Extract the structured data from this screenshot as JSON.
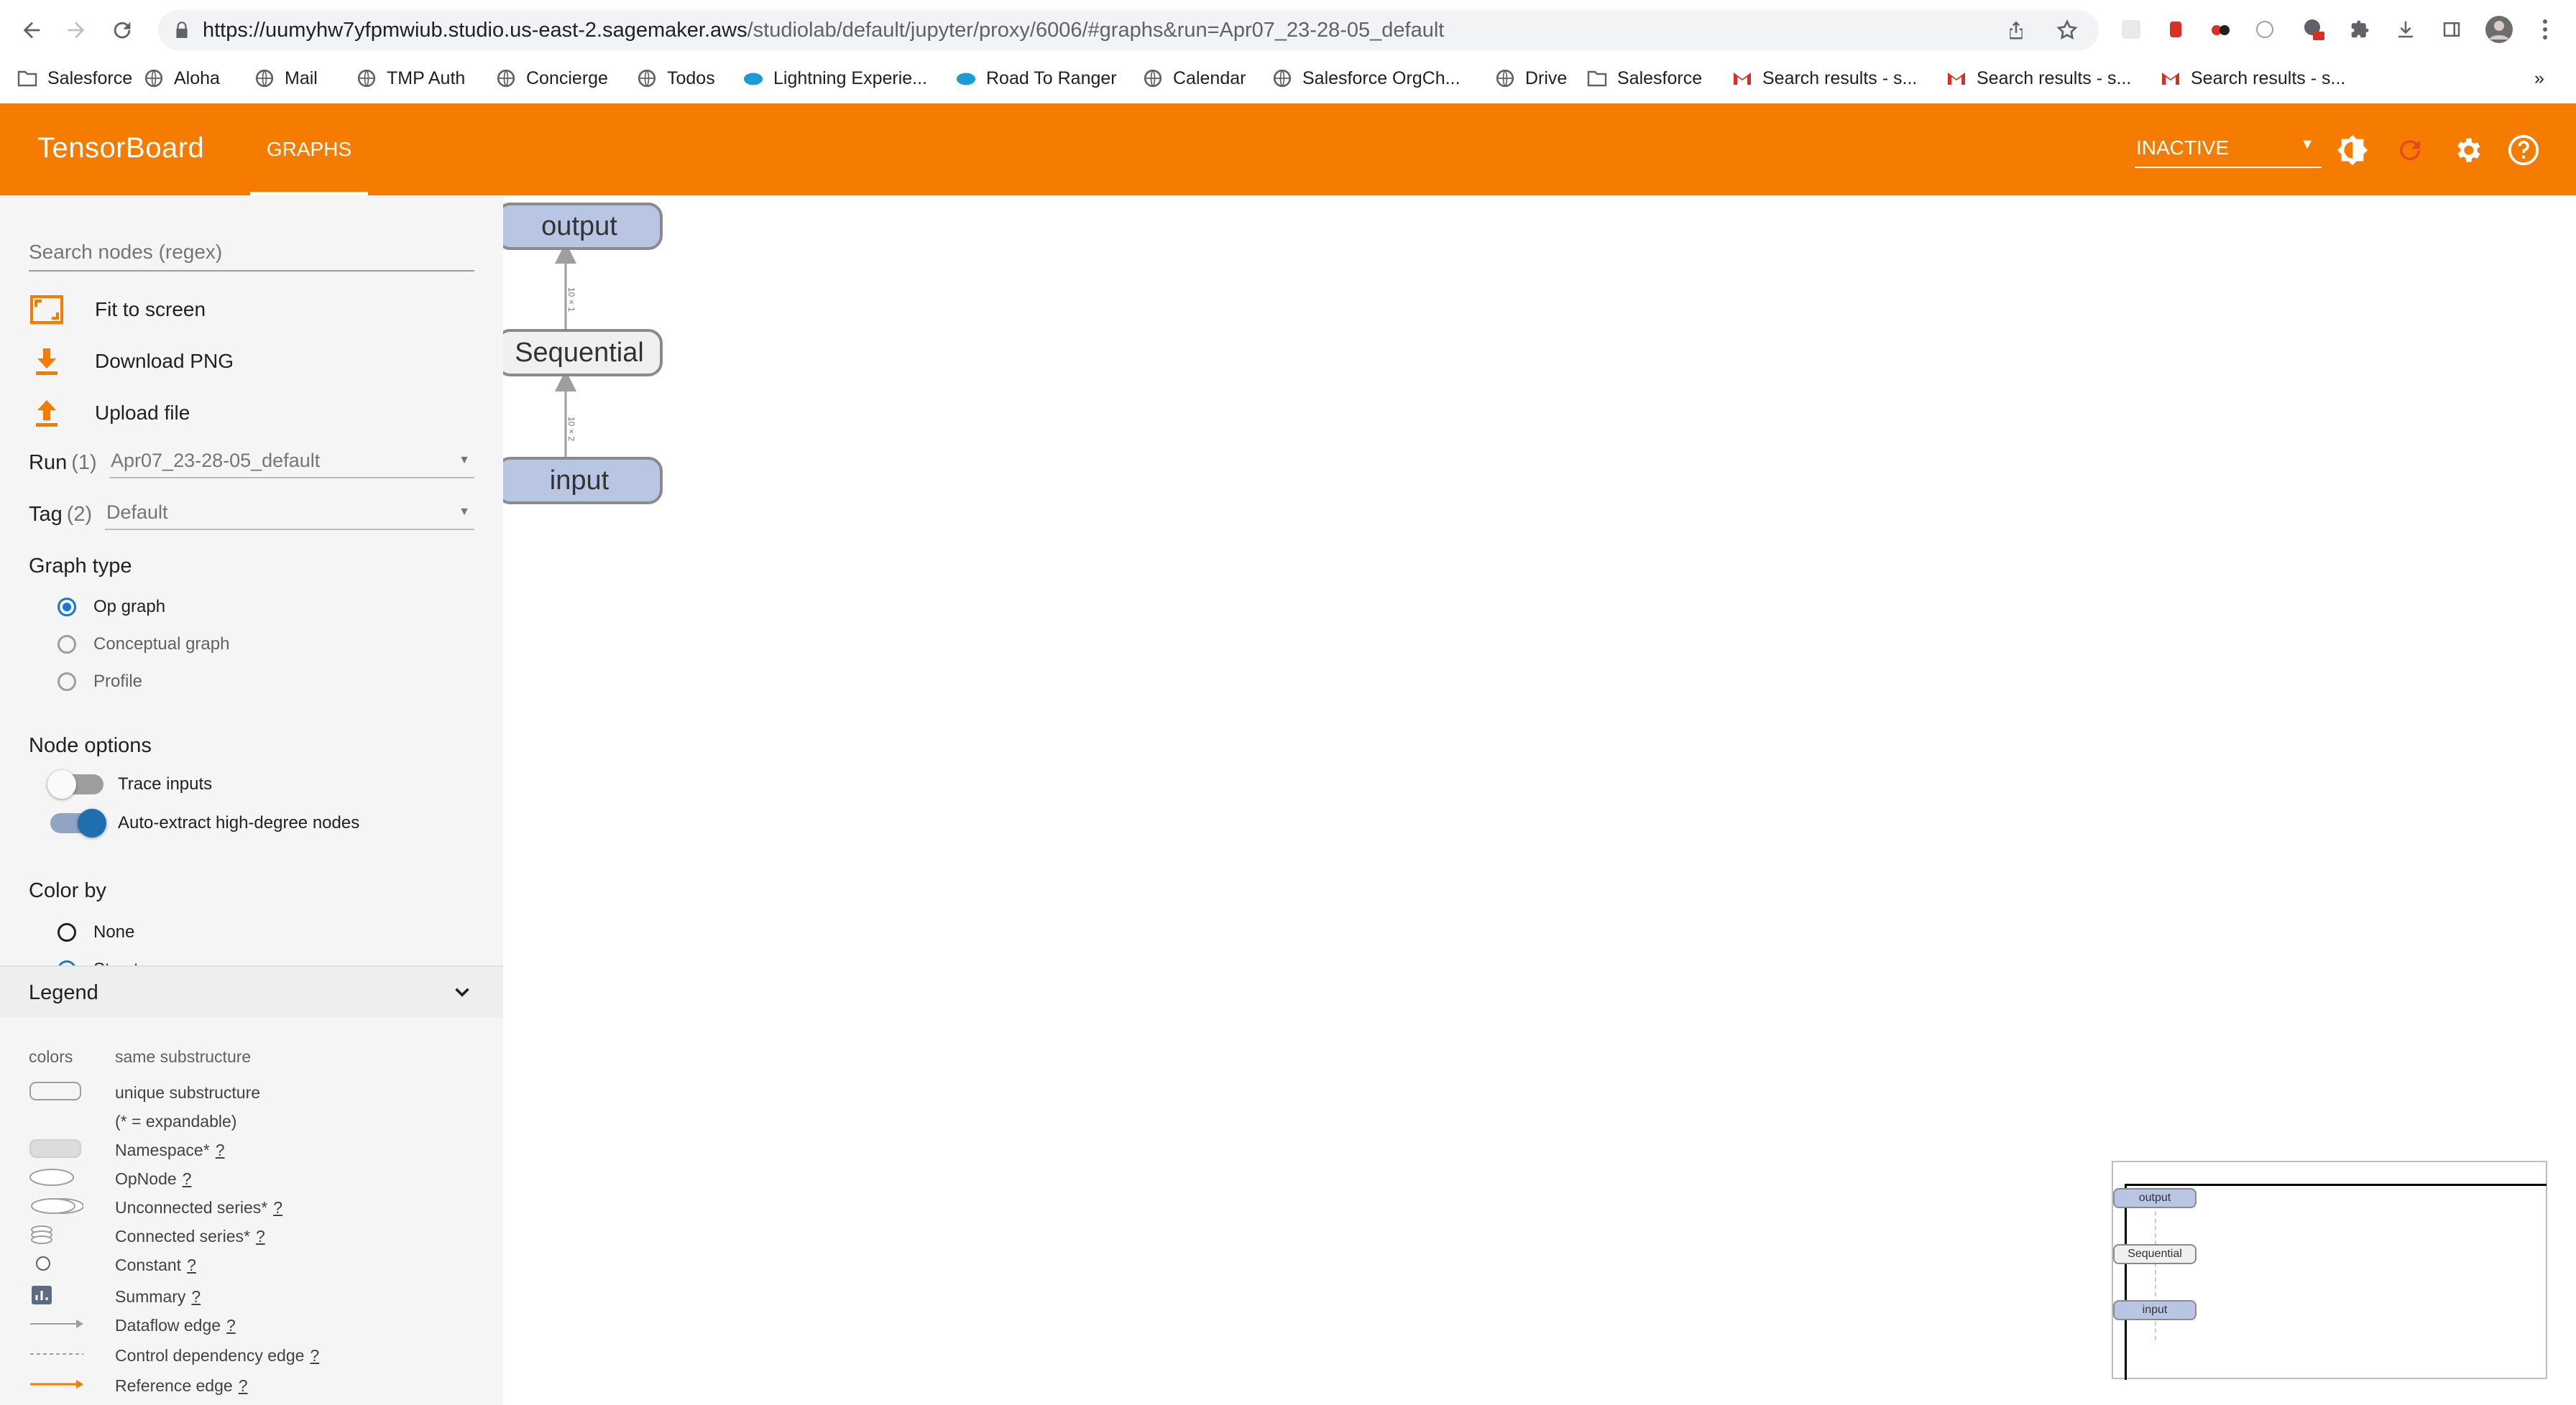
{
  "browser": {
    "url_host": "https://uumyhw7yfpmwiub.studio.us-east-2.sagemaker.aws",
    "url_path": "/studiolab/default/jupyter/proxy/6006/#graphs&run=Apr07_23-28-05_default",
    "bookmarks": [
      {
        "label": "Salesforce",
        "icon": "salesforce-folder-icon"
      },
      {
        "label": "Aloha",
        "icon": "globe-icon"
      },
      {
        "label": "Mail",
        "icon": "globe-icon"
      },
      {
        "label": "TMP Auth",
        "icon": "globe-icon"
      },
      {
        "label": "Concierge",
        "icon": "globe-icon"
      },
      {
        "label": "Todos",
        "icon": "globe-icon"
      },
      {
        "label": "Lightning Experie...",
        "icon": "salesforce-cloud-icon"
      },
      {
        "label": "Road To Ranger",
        "icon": "salesforce-cloud-icon"
      },
      {
        "label": "Calendar",
        "icon": "globe-icon"
      },
      {
        "label": "Salesforce OrgCh...",
        "icon": "globe-icon"
      },
      {
        "label": "Drive",
        "icon": "globe-icon"
      },
      {
        "label": "Salesforce",
        "icon": "folder-icon"
      },
      {
        "label": "Search results - s...",
        "icon": "gmail-icon"
      },
      {
        "label": "Search results - s...",
        "icon": "gmail-icon"
      },
      {
        "label": "Search results - s...",
        "icon": "gmail-icon"
      }
    ],
    "more_bookmarks": "»"
  },
  "header": {
    "logo": "TensorBoard",
    "tab": "GRAPHS",
    "status": "INACTIVE",
    "accent_color": "#f57c00"
  },
  "sidebar": {
    "search_placeholder": "Search nodes (regex)",
    "actions": {
      "fit": "Fit to screen",
      "download": "Download PNG",
      "upload": "Upload file"
    },
    "run": {
      "label": "Run",
      "count": "(1)",
      "value": "Apr07_23-28-05_default"
    },
    "tag": {
      "label": "Tag",
      "count": "(2)",
      "value": "Default"
    },
    "graph_type": {
      "title": "Graph type",
      "options": [
        "Op graph",
        "Conceptual graph",
        "Profile"
      ],
      "selected": "Op graph"
    },
    "node_options": {
      "title": "Node options",
      "trace_inputs": "Trace inputs",
      "auto_extract": "Auto-extract high-degree nodes"
    },
    "color_by": {
      "title": "Color by",
      "options": [
        "None",
        "Structure"
      ]
    },
    "legend": {
      "title": "Legend",
      "colors_label": "colors",
      "colors_value": "same substructure",
      "items": [
        {
          "label": "unique substructure",
          "help": ""
        },
        {
          "label": "(* = expandable)",
          "help": ""
        },
        {
          "label": "Namespace*",
          "help": "?"
        },
        {
          "label": "OpNode",
          "help": "?"
        },
        {
          "label": "Unconnected series*",
          "help": "?"
        },
        {
          "label": "Connected series*",
          "help": "?"
        },
        {
          "label": "Constant",
          "help": "?"
        },
        {
          "label": "Summary",
          "help": "?"
        },
        {
          "label": "Dataflow edge",
          "help": "?"
        },
        {
          "label": "Control dependency edge",
          "help": "?"
        },
        {
          "label": "Reference edge",
          "help": "?"
        }
      ]
    }
  },
  "graph": {
    "nodes": {
      "output": "output",
      "sequential": "Sequential",
      "input": "input"
    },
    "edge_labels": {
      "top": "10×1",
      "bottom": "10×2"
    }
  }
}
